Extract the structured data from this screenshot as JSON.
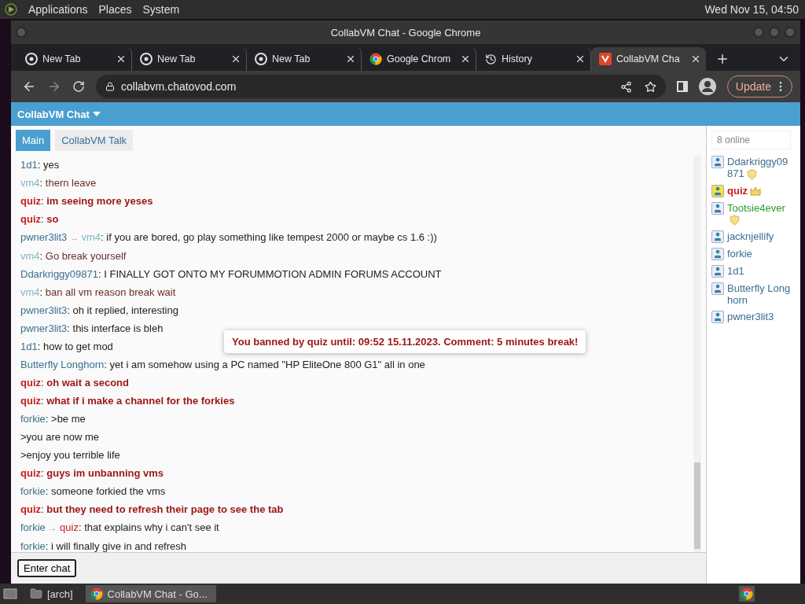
{
  "desktop_bar": {
    "menus": [
      "Applications",
      "Places",
      "System"
    ],
    "clock": "Wed Nov 15, 04:50"
  },
  "window": {
    "title": "CollabVM Chat - Google Chrome"
  },
  "browser_tabs": [
    {
      "title": "New Tab",
      "kind": "newtab",
      "selected": false
    },
    {
      "title": "New Tab",
      "kind": "newtab",
      "selected": false
    },
    {
      "title": "New Tab",
      "kind": "newtab",
      "selected": false
    },
    {
      "title": "Google Chrom",
      "kind": "browser",
      "selected": false
    },
    {
      "title": "History",
      "kind": "history",
      "selected": false
    },
    {
      "title": "CollabVM Cha",
      "kind": "site",
      "selected": true
    }
  ],
  "address_bar": {
    "url": "collabvm.chatovod.com",
    "update_button": "Update"
  },
  "chat": {
    "title": "CollabVM Chat",
    "rooms": [
      {
        "label": "Main",
        "selected": true
      },
      {
        "label": "CollabVM Talk",
        "selected": false
      }
    ],
    "messages": [
      {
        "author": {
          "name": "1d1",
          "kind": "user"
        },
        "sep": ":",
        "kind": "user",
        "text": "yes"
      },
      {
        "author": {
          "name": "vm4",
          "kind": "guest"
        },
        "sep": ":",
        "kind": "guest",
        "text": "thern leave"
      },
      {
        "author": {
          "name": "quiz",
          "kind": "admin"
        },
        "sep": ":",
        "kind": "admin",
        "text": "im seeing more yeses"
      },
      {
        "author": {
          "name": "quiz",
          "kind": "admin"
        },
        "sep": ":",
        "kind": "admin",
        "text": "so"
      },
      {
        "author": {
          "name": "pwner3lit3",
          "kind": "user"
        },
        "arrow": "→",
        "to": {
          "name": "vm4",
          "kind": "guest"
        },
        "sep": ":",
        "kind": "user",
        "text": "if you are bored, go play something like tempest 2000 or maybe cs 1.6 :))"
      },
      {
        "author": {
          "name": "vm4",
          "kind": "guest"
        },
        "sep": ":",
        "kind": "guest",
        "text": "Go break yourself"
      },
      {
        "author": {
          "name": "Ddarkriggy09871",
          "kind": "user"
        },
        "sep": ":",
        "kind": "user",
        "text": "I FINALLY GOT ONTO MY FORUMMOTION ADMIN FORUMS ACCOUNT"
      },
      {
        "author": {
          "name": "vm4",
          "kind": "guest"
        },
        "sep": ":",
        "kind": "guest",
        "text": "ban all vm reason break wait"
      },
      {
        "author": {
          "name": "pwner3lit3",
          "kind": "user"
        },
        "sep": ":",
        "kind": "user",
        "text": "oh it replied, interesting"
      },
      {
        "author": {
          "name": "pwner3lit3",
          "kind": "user"
        },
        "sep": ":",
        "kind": "user",
        "text": "this interface is bleh"
      },
      {
        "author": {
          "name": "1d1",
          "kind": "user"
        },
        "sep": ":",
        "kind": "user",
        "text": "how to get mod"
      },
      {
        "author": {
          "name": "Butterfly Longhorn",
          "kind": "user"
        },
        "sep": ":",
        "kind": "user",
        "text": "yet i am somehow using a PC named \"HP EliteOne 800 G1\" all in one"
      },
      {
        "author": {
          "name": "quiz",
          "kind": "admin"
        },
        "sep": ":",
        "kind": "admin",
        "text": "oh wait a second"
      },
      {
        "author": {
          "name": "quiz",
          "kind": "admin"
        },
        "sep": ":",
        "kind": "admin",
        "text": "what if i make a channel for the forkies"
      },
      {
        "author": {
          "name": "forkie",
          "kind": "user"
        },
        "sep": ":",
        "kind": "user",
        "text": ">be me"
      },
      {
        "kind": "user",
        "text": ">you are now me"
      },
      {
        "kind": "user",
        "text": ">enjoy you terrible life"
      },
      {
        "author": {
          "name": "quiz",
          "kind": "admin"
        },
        "sep": ":",
        "kind": "admin",
        "text": "guys im unbanning vms"
      },
      {
        "author": {
          "name": "forkie",
          "kind": "user"
        },
        "sep": ":",
        "kind": "user",
        "text": "someone forkied the vms"
      },
      {
        "author": {
          "name": "quiz",
          "kind": "admin"
        },
        "sep": ":",
        "kind": "admin",
        "text": "but they need to refresh their page to see the tab"
      },
      {
        "author": {
          "name": "forkie",
          "kind": "user"
        },
        "arrow": "→",
        "to": {
          "name": "quiz",
          "kind": "admin"
        },
        "sep": ":",
        "kind": "user",
        "text": "that explains why i can't see it"
      },
      {
        "author": {
          "name": "forkie",
          "kind": "user"
        },
        "sep": ":",
        "kind": "user",
        "text": "i will finally give in and refresh"
      }
    ],
    "ban_notice": "You banned by quiz until: 09:52 15.11.2023. Comment: 5 minutes break!",
    "enter_button": "Enter chat",
    "online_count": "8 online",
    "users": [
      {
        "name": "Ddarkriggy09871",
        "kind": "mod",
        "color": "#3b6f8f"
      },
      {
        "name": "quiz",
        "kind": "admin",
        "color": "#c81e1e"
      },
      {
        "name": "Tootsie4ever",
        "kind": "mod",
        "color": "#2a9a2a"
      },
      {
        "name": "jacknjellify",
        "kind": "user",
        "color": "#3b6f8f"
      },
      {
        "name": "forkie",
        "kind": "user",
        "color": "#3b6f8f"
      },
      {
        "name": "1d1",
        "kind": "user",
        "color": "#3b6f8f"
      },
      {
        "name": "Butterfly Longhorn",
        "kind": "user",
        "color": "#3b6f8f"
      },
      {
        "name": "pwner3lit3",
        "kind": "user",
        "color": "#3b6f8f"
      }
    ]
  },
  "taskbar": {
    "items": [
      {
        "label": "[arch]",
        "kind": "folder",
        "selected": false
      },
      {
        "label": "CollabVM Chat - Go...",
        "kind": "browser",
        "selected": true
      }
    ]
  }
}
